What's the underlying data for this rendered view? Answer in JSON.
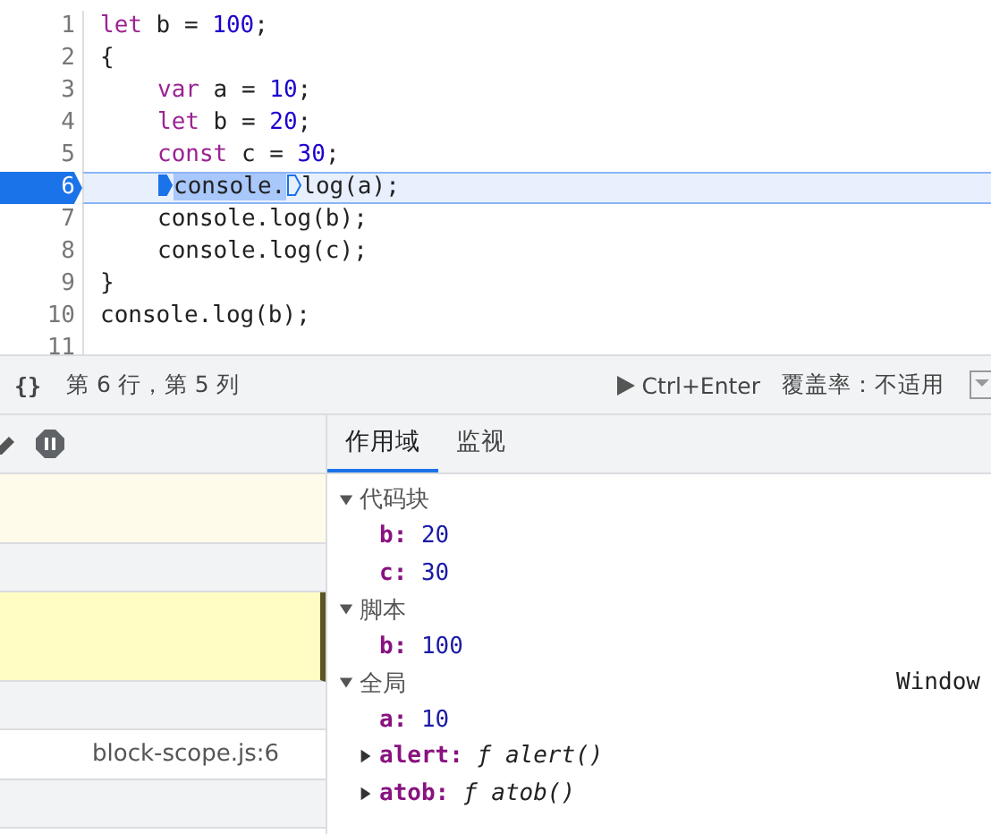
{
  "editor": {
    "lines": [
      {
        "number": "1",
        "current": false,
        "indented": false,
        "tokens": [
          {
            "kind": "keyword",
            "text": "let"
          },
          {
            "kind": "plain",
            "text": " b = "
          },
          {
            "kind": "number",
            "text": "100"
          },
          {
            "kind": "plain",
            "text": ";"
          }
        ]
      },
      {
        "number": "2",
        "current": false,
        "indented": false,
        "tokens": [
          {
            "kind": "plain",
            "text": "{"
          }
        ]
      },
      {
        "number": "3",
        "current": false,
        "indented": true,
        "tokens": [
          {
            "kind": "keyword",
            "text": "var"
          },
          {
            "kind": "plain",
            "text": " a = "
          },
          {
            "kind": "number",
            "text": "10"
          },
          {
            "kind": "plain",
            "text": ";"
          }
        ]
      },
      {
        "number": "4",
        "current": false,
        "indented": true,
        "tokens": [
          {
            "kind": "keyword",
            "text": "let"
          },
          {
            "kind": "plain",
            "text": " b = "
          },
          {
            "kind": "number",
            "text": "20"
          },
          {
            "kind": "plain",
            "text": ";"
          }
        ]
      },
      {
        "number": "5",
        "current": false,
        "indented": true,
        "tokens": [
          {
            "kind": "keyword",
            "text": "const"
          },
          {
            "kind": "plain",
            "text": " c = "
          },
          {
            "kind": "number",
            "text": "30"
          },
          {
            "kind": "plain",
            "text": ";"
          }
        ]
      },
      {
        "number": "6",
        "current": true,
        "indented": true,
        "tokens": [
          {
            "kind": "marker",
            "active": true
          },
          {
            "kind": "highlight",
            "text": "console."
          },
          {
            "kind": "marker",
            "active": false
          },
          {
            "kind": "plain",
            "text": "log(a);"
          }
        ]
      },
      {
        "number": "7",
        "current": false,
        "indented": true,
        "tokens": [
          {
            "kind": "plain",
            "text": "console.log(b);"
          }
        ]
      },
      {
        "number": "8",
        "current": false,
        "indented": true,
        "tokens": [
          {
            "kind": "plain",
            "text": "console.log(c);"
          }
        ]
      },
      {
        "number": "9",
        "current": false,
        "indented": false,
        "tokens": [
          {
            "kind": "plain",
            "text": "}"
          }
        ]
      },
      {
        "number": "10",
        "current": false,
        "indented": false,
        "tokens": [
          {
            "kind": "plain",
            "text": "console.log(b);"
          }
        ]
      },
      {
        "number": "11",
        "current": false
      }
    ]
  },
  "status_bar": {
    "format_icon": "{}",
    "position": "第 6 行，第 5 列",
    "run": "Ctrl+Enter",
    "coverage": "覆盖率：不适用"
  },
  "call_stack": {
    "rows": [
      {
        "kind": "paused"
      },
      {
        "kind": "gap"
      },
      {
        "kind": "current"
      },
      {
        "kind": "gap"
      },
      {
        "kind": "frame",
        "location": "block-scope.js:6"
      },
      {
        "kind": "gap"
      }
    ]
  },
  "scope_tabs": [
    {
      "label": "作用域",
      "selected": true
    },
    {
      "label": "监视",
      "selected": false
    }
  ],
  "scopes": [
    {
      "title": "代码块",
      "expanded": true,
      "children": [
        {
          "name": "b:",
          "value": "20",
          "kind": "number"
        },
        {
          "name": "c:",
          "value": "30",
          "kind": "number"
        }
      ]
    },
    {
      "title": "脚本",
      "expanded": true,
      "children": [
        {
          "name": "b:",
          "value": "100",
          "kind": "number"
        }
      ]
    },
    {
      "title": "全局",
      "expanded": true,
      "aside": "Window",
      "children": [
        {
          "name": "a:",
          "value": "10",
          "kind": "number"
        },
        {
          "name": "alert:",
          "value": "ƒ alert()",
          "kind": "function"
        },
        {
          "name": "atob:",
          "value": "ƒ atob()",
          "kind": "function"
        }
      ]
    }
  ]
}
